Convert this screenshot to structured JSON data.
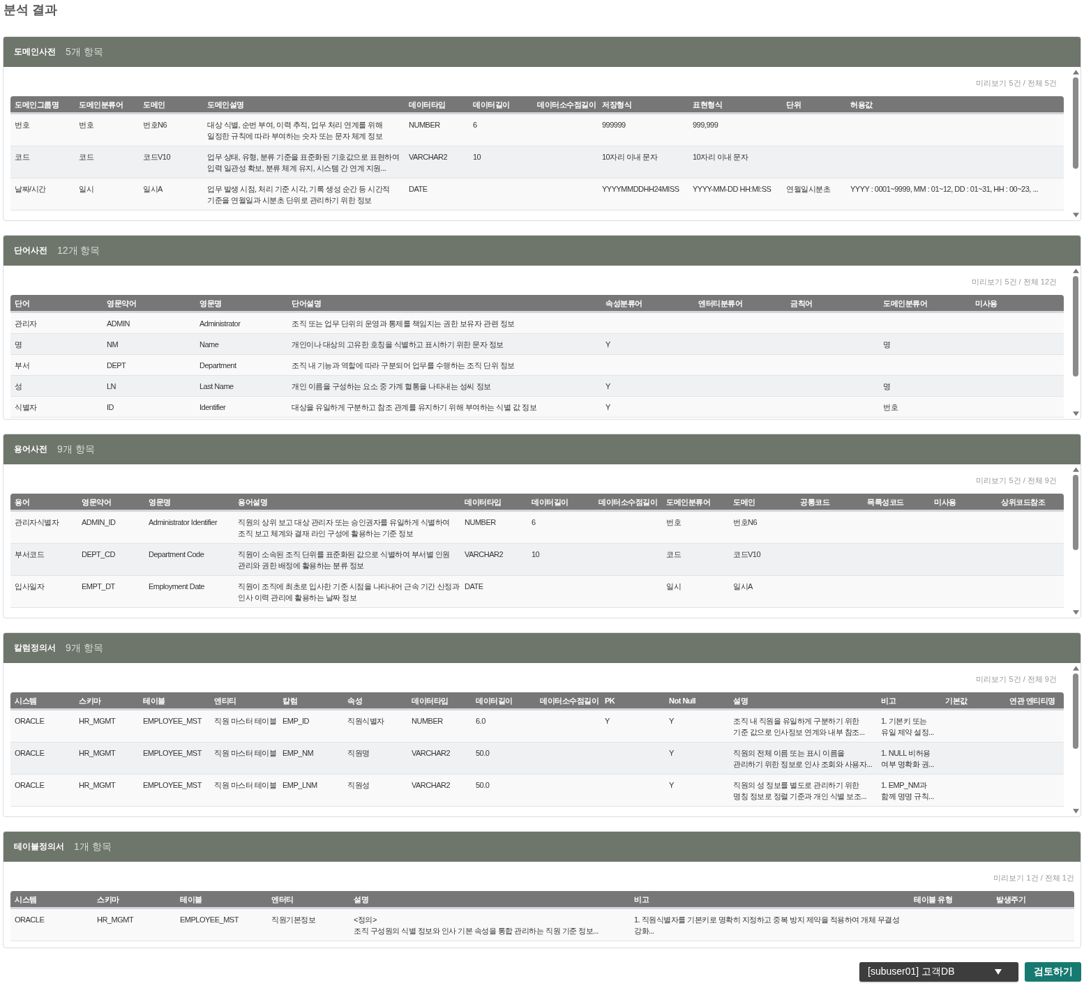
{
  "page": {
    "title": "분석 결과"
  },
  "sections": [
    {
      "title": "도메인사전",
      "count": "5개 항목",
      "preview": "미리보기 5건 / 전체 5건",
      "scrollable": true,
      "columns": [
        "도메인그룹명",
        "도메인분류어",
        "도메인",
        "도메인설명",
        "데이터타입",
        "데이터길이",
        "데이터소수점길이",
        "저장형식",
        "표현형식",
        "단위",
        "허용값"
      ],
      "rows": [
        [
          "번호",
          "번호",
          "번호N6",
          "대상 식별, 순번 부여, 이력 추적, 업무 처리 연계를 위해\n일정한 규칙에 따라 부여하는 숫자 또는 문자 체계 정보",
          "NUMBER",
          "6",
          null,
          "999999",
          "999,999",
          null,
          null
        ],
        [
          "코드",
          "코드",
          "코드V10",
          "업무 상태, 유형, 분류 기준을 표준화된 기호값으로 표현하여\n입력 일관성 확보, 분류 체계 유지, 시스템 간 연계 지원...",
          "VARCHAR2",
          "10",
          null,
          "10자리 이내 문자",
          "10자리 이내 문자",
          null,
          null
        ],
        [
          "날짜/시간",
          "일시",
          "일시A",
          "업무 발생 시점, 처리 기준 시각, 기록 생성 순간 등 시간적\n기준을 연월일과 시분초 단위로 관리하기 위한 정보",
          "DATE",
          null,
          null,
          "YYYYMMDDHH24MISS",
          "YYYY-MM-DD HH:MI:SS",
          "연월일시분초",
          "YYYY : 0001~9999, MM : 01~12, DD : 01~31, HH : 00~23, ..."
        ]
      ]
    },
    {
      "title": "단어사전",
      "count": "12개 항목",
      "preview": "미리보기 5건 / 전체 12건",
      "scrollable": true,
      "columns": [
        "단어",
        "영문약어",
        "영문명",
        "단어설명",
        "속성분류어",
        "엔터티분류어",
        "금칙어",
        "도메인분류어",
        "미사용"
      ],
      "rows": [
        [
          "관리자",
          "ADMIN",
          "Administrator",
          "조직 또는 업무 단위의 운영과 통제를 책임지는 권한 보유자 관련 정보",
          null,
          null,
          null,
          null,
          null
        ],
        [
          "명",
          "NM",
          "Name",
          "개인이나 대상의 고유한 호칭을 식별하고 표시하기 위한 문자 정보",
          "Y",
          null,
          null,
          "명",
          null
        ],
        [
          "부서",
          "DEPT",
          "Department",
          "조직 내 기능과 역할에 따라 구분되어 업무를 수행하는 조직 단위 정보",
          null,
          null,
          null,
          null,
          null
        ],
        [
          "성",
          "LN",
          "Last Name",
          "개인 이름을 구성하는 요소 중 가계 혈통을 나타내는 성씨 정보",
          "Y",
          null,
          null,
          "명",
          null
        ],
        [
          "식별자",
          "ID",
          "Identifier",
          "대상을 유일하게 구분하고 참조 관계를 유지하기 위해 부여하는 식별 값 정보",
          "Y",
          null,
          null,
          "번호",
          null
        ]
      ]
    },
    {
      "title": "용어사전",
      "count": "9개 항목",
      "preview": "미리보기 5건 / 전체 9건",
      "scrollable": true,
      "columns": [
        "용어",
        "영문약어",
        "영문명",
        "용어설명",
        "데이터타입",
        "데이터길이",
        "데이터소수점길이",
        "도메인분류어",
        "도메인",
        "공통코드",
        "목록성코드",
        "미사용",
        "상위코드참조"
      ],
      "rows": [
        [
          "관리자식별자",
          "ADMIN_ID",
          "Administrator Identifier",
          "직원의 상위 보고 대상 관리자 또는 승인권자를 유일하게 식별하여\n조직 보고 체계와 결재 라인 구성에 활용하는 기준 정보",
          "NUMBER",
          "6",
          null,
          "번호",
          "번호N6",
          null,
          null,
          null,
          null
        ],
        [
          "부서코드",
          "DEPT_CD",
          "Department Code",
          "직원이 소속된 조직 단위를 표준화된 값으로 식별하여 부서별 인원\n관리와 권한 배정에 활용하는 분류 정보",
          "VARCHAR2",
          "10",
          null,
          "코드",
          "코드V10",
          null,
          null,
          null,
          null
        ],
        [
          "입사일자",
          "EMPT_DT",
          "Employment Date",
          "직원이 조직에 최초로 입사한 기준 시점을 나타내어 근속 기간 산정과\n인사 이력 관리에 활용하는 날짜 정보",
          "DATE",
          null,
          null,
          "일시",
          "일시A",
          null,
          null,
          null,
          null
        ]
      ]
    },
    {
      "title": "칼럼정의서",
      "count": "9개 항목",
      "preview": "미리보기 5건 / 전체 9건",
      "scrollable": true,
      "columns": [
        "시스템",
        "스키마",
        "테이블",
        "엔티티",
        "칼럼",
        "속성",
        "데이터타입",
        "데이터길이",
        "데이터소수점길이",
        "PK",
        "Not Null",
        "설명",
        "비고",
        "기본값",
        "연관 엔티티명"
      ],
      "rows": [
        [
          "ORACLE",
          "HR_MGMT",
          "EMPLOYEE_MST",
          "직원 마스터 테이블",
          "EMP_ID",
          "직원식별자",
          "NUMBER",
          "6.0",
          null,
          "Y",
          "Y",
          "조직 내 직원을 유일하게 구분하기 위한\n기준 값으로 인사정보 연계와 내부 참조...",
          "1. 기본키 또는\n유일 제약 설정...",
          null,
          null
        ],
        [
          "ORACLE",
          "HR_MGMT",
          "EMPLOYEE_MST",
          "직원 마스터 테이블",
          "EMP_NM",
          "직원명",
          "VARCHAR2",
          "50.0",
          null,
          null,
          "Y",
          "직원의 전체 이름 또는 표시 이름을\n관리하기 위한 정보로 인사 조회와 사용자...",
          "1. NULL 비허용\n여부 명확화 권...",
          null,
          null
        ],
        [
          "ORACLE",
          "HR_MGMT",
          "EMPLOYEE_MST",
          "직원 마스터 테이블",
          "EMP_LNM",
          "직원성",
          "VARCHAR2",
          "50.0",
          null,
          null,
          "Y",
          "직원의 성 정보를 별도로 관리하기 위한\n명칭 정보로 정렬 기준과 개인 식별 보조...",
          "1. EMP_NM과\n함께 명명 규칙...",
          null,
          null
        ]
      ]
    },
    {
      "title": "테이블정의서",
      "count": "1개 항목",
      "preview": "미리보기 1건 / 전체 1건",
      "scrollable": false,
      "columns": [
        "시스템",
        "스키마",
        "테이블",
        "엔터티",
        "설명",
        "비고",
        "테이블 유형",
        "발생주기"
      ],
      "rows": [
        [
          "ORACLE",
          "HR_MGMT",
          "EMPLOYEE_MST",
          "직원기본정보",
          "<정의>\n조직 구성원의 식별 정보와 인사 기본 속성을 통합 관리하는 직원 기준 정보...",
          "1. 직원식별자를 기본키로 명확히 지정하고 중복 방지 제약을 적용하여 개체 무결성\n강화...",
          null,
          null
        ]
      ]
    }
  ],
  "footer": {
    "database_select": {
      "value": "[subuser01] 고객DB"
    },
    "review_button": "검토하기"
  }
}
